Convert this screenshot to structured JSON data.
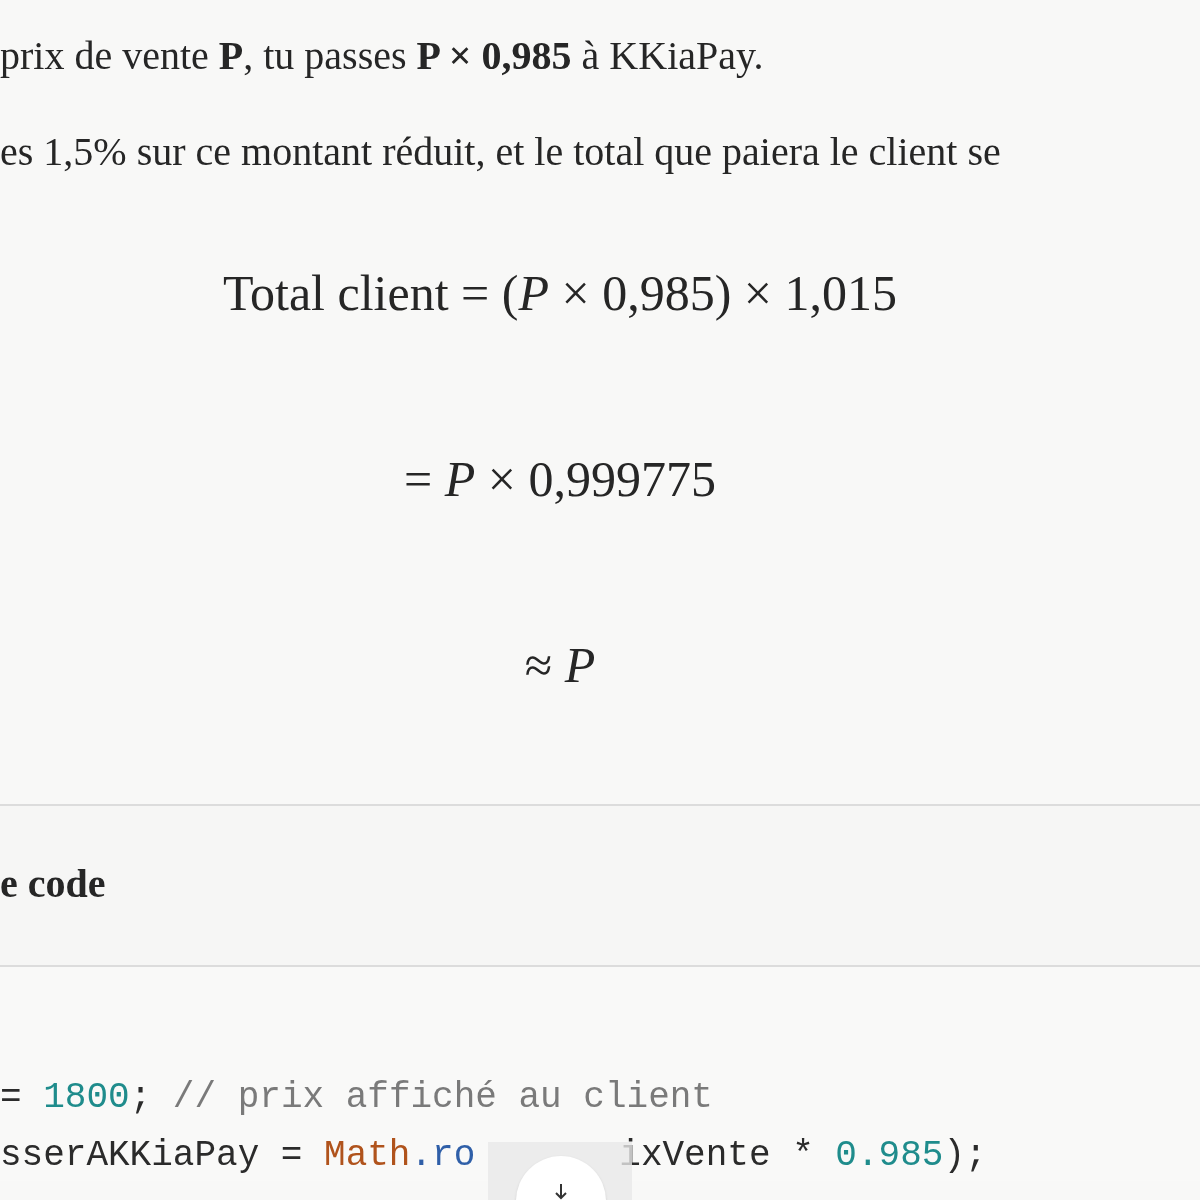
{
  "paragraphs": [
    "prix de vente **P**, tu passes **P × 0,985** à KKiaPay.",
    "es 1,5% sur ce montant réduit, et le total que paiera le client se"
  ],
  "equations": [
    "Total client = (*P* × 0,985) × 1,015",
    "= *P* × 0,999775",
    "≈ *P*"
  ],
  "heading": "e code",
  "code_lines": [
    {
      "parts": [
        [
          {
            "text": "= ",
            "kind": "plain"
          },
          {
            "text": "1800",
            "kind": "number"
          },
          {
            "text": "; ",
            "kind": "plain"
          },
          {
            "text": "// prix affiché au client",
            "kind": "comment"
          }
        ]
      ]
    },
    {
      "parts": [
        [
          {
            "text": "sserAKKiaPay = ",
            "kind": "plain"
          },
          {
            "text": "Math",
            "kind": "class"
          },
          {
            "text": ".ro",
            "kind": "method"
          }
        ],
        [
          {
            "text": "ixVente * ",
            "kind": "plain"
          },
          {
            "text": "0.985",
            "kind": "number"
          },
          {
            "text": ");",
            "kind": "plain"
          }
        ]
      ]
    }
  ]
}
